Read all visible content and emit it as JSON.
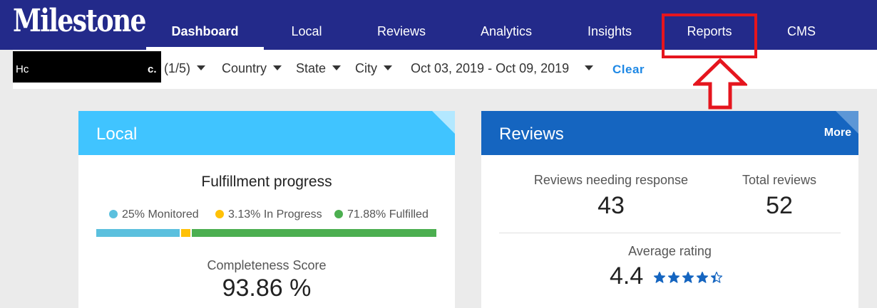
{
  "app": {
    "logo": "Milestone"
  },
  "nav": {
    "items": [
      {
        "label": "Dashboard"
      },
      {
        "label": "Local"
      },
      {
        "label": "Reviews"
      },
      {
        "label": "Analytics"
      },
      {
        "label": "Insights"
      },
      {
        "label": "Reports"
      },
      {
        "label": "CMS"
      }
    ],
    "active": "Dashboard"
  },
  "filters": {
    "location_text": "Hc",
    "location_tail": "c.",
    "location_count": "(1/5)",
    "country": "Country",
    "state": "State",
    "city": "City",
    "date_range": "Oct 03, 2019 - Oct 09, 2019",
    "clear": "Clear"
  },
  "local_card": {
    "title": "Local",
    "fulfillment_title": "Fulfillment progress",
    "legend": [
      {
        "label": "25% Monitored",
        "color": "#5bc0de",
        "percent": 25
      },
      {
        "label": "3.13% In Progress",
        "color": "#ffc107",
        "percent": 3.13
      },
      {
        "label": "71.88% Fulfilled",
        "color": "#4caf50",
        "percent": 71.88
      }
    ],
    "completeness_label": "Completeness Score",
    "completeness_value": "93.86 %"
  },
  "reviews_card": {
    "title": "Reviews",
    "more": "More",
    "needing_response_label": "Reviews needing response",
    "needing_response_value": "43",
    "total_label": "Total reviews",
    "total_value": "52",
    "avg_label": "Average rating",
    "avg_value": "4.4",
    "rating": 4.4
  },
  "colors": {
    "nav_bg": "#232a8a",
    "local_header": "#40c4ff",
    "reviews_header": "#1565c0",
    "accent_link": "#1e88e5",
    "annotation_red": "#e5151e",
    "star": "#1565c0"
  }
}
